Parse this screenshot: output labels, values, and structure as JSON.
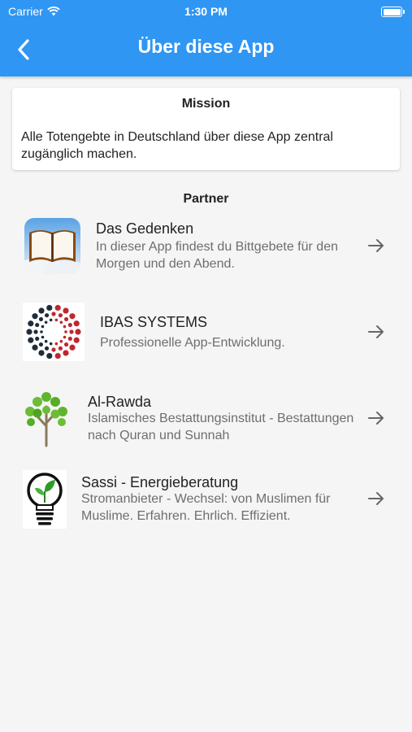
{
  "status_bar": {
    "carrier": "Carrier",
    "time": "1:30 PM"
  },
  "nav": {
    "title": "Über diese App",
    "back_icon": "chevron-left-icon"
  },
  "mission": {
    "heading": "Mission",
    "text": "Alle Totengebte in Deutschland über diese App zentral zugänglich machen."
  },
  "partners": {
    "heading": "Partner",
    "items": [
      {
        "name": "Das Gedenken",
        "description": "In dieser App findest du Bittgebete für den Morgen und den Abend.",
        "logo": "open-book-icon"
      },
      {
        "name": "IBAS SYSTEMS",
        "description": "Professionelle App-Entwicklung.",
        "logo": "dot-circle-logo"
      },
      {
        "name": "Al-Rawda",
        "description": "Islamisches Bestattungsinstitut - Bestattungen nach Quran und Sunnah",
        "logo": "tree-logo"
      },
      {
        "name": "Sassi - Energieberatung",
        "description": "Stromanbieter - Wechsel: von Muslimen für Muslime. Erfahren. Ehrlich. Effizient.",
        "logo": "lightbulb-leaf-logo"
      }
    ]
  },
  "colors": {
    "accent": "#2f96f3",
    "background": "#f5f5f5",
    "text": "#222222",
    "muted": "#6e6e6e"
  }
}
